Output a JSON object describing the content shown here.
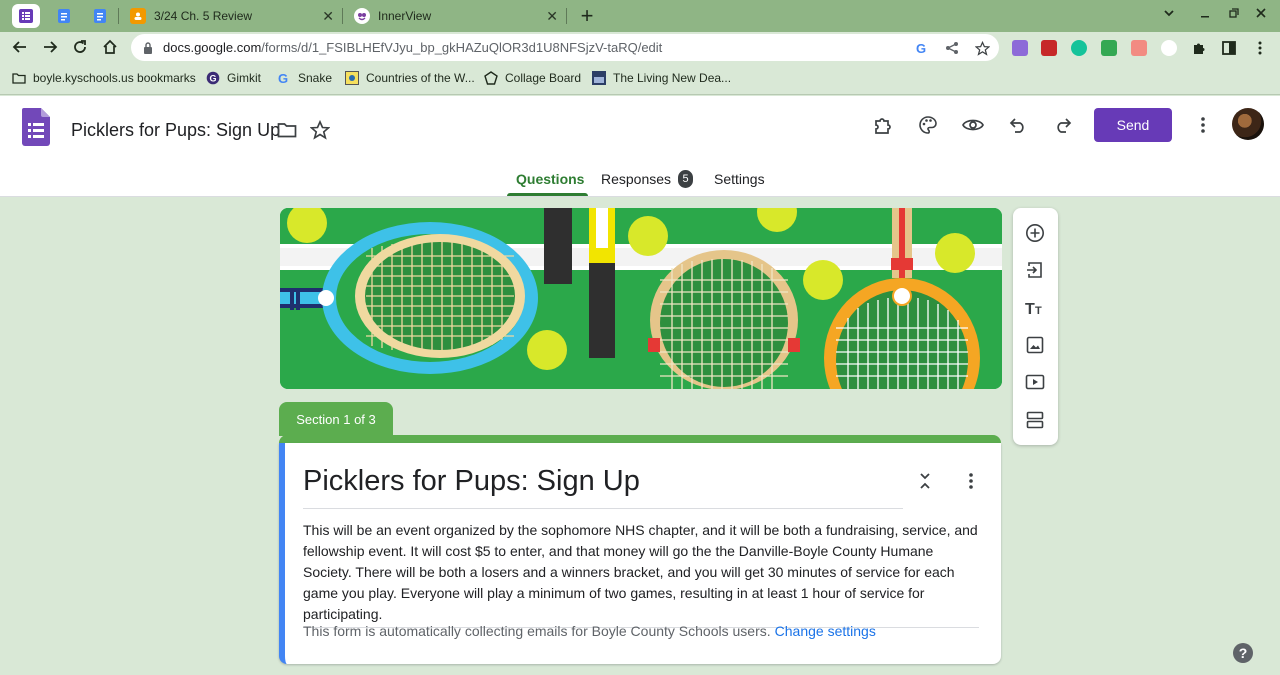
{
  "browser": {
    "tabs": [
      {
        "title": "3/24 Ch. 5 Review",
        "icon": "classroom-icon"
      },
      {
        "title": "InnerView",
        "icon": "innerview-icon"
      }
    ],
    "url_host": "docs.google.com",
    "url_path": "/forms/d/1_FSIBLHEfVJyu_bp_gkHAZuQlOR3d1U8NFSjzV-taRQ/edit",
    "bookmarks": [
      {
        "label": "boyle.kyschools.us bookmarks",
        "icon": "folder-icon"
      },
      {
        "label": "Gimkit",
        "icon": "gimkit-icon"
      },
      {
        "label": "Snake",
        "icon": "google-icon"
      },
      {
        "label": "Countries of the W...",
        "icon": "countries-icon"
      },
      {
        "label": "Collage Board",
        "icon": "collegeboard-icon"
      },
      {
        "label": "The Living New Dea...",
        "icon": "livingnewdeal-icon"
      }
    ]
  },
  "header": {
    "doc_title": "Picklers for Pups: Sign Up",
    "send_label": "Send",
    "tabs": {
      "questions": "Questions",
      "responses": "Responses",
      "responses_count": "5",
      "settings": "Settings"
    }
  },
  "form": {
    "section_label": "Section 1 of 3",
    "title": "Picklers for Pups: Sign Up",
    "description": "This will be an event organized by the sophomore NHS chapter, and it will be both a fundraising, service, and fellowship event. It will cost $5 to enter, and that money will go the the Danville-Boyle County Humane Society. There will be both a losers and a winners bracket, and you will get 30 minutes of service for each game you play. Everyone will play a minimum of two games, resulting in at least 1 hour of service for participating.",
    "email_note": "This form is automatically collecting emails for Boyle County Schools users.",
    "change_settings": "Change settings"
  },
  "colors": {
    "accent": "#673ab7",
    "section_green": "#5cad4f",
    "tab_active": "#2e7d32",
    "card_left_border": "#4285f4",
    "link": "#1a73e8",
    "background": "#d9e8d6"
  },
  "help_label": "?"
}
